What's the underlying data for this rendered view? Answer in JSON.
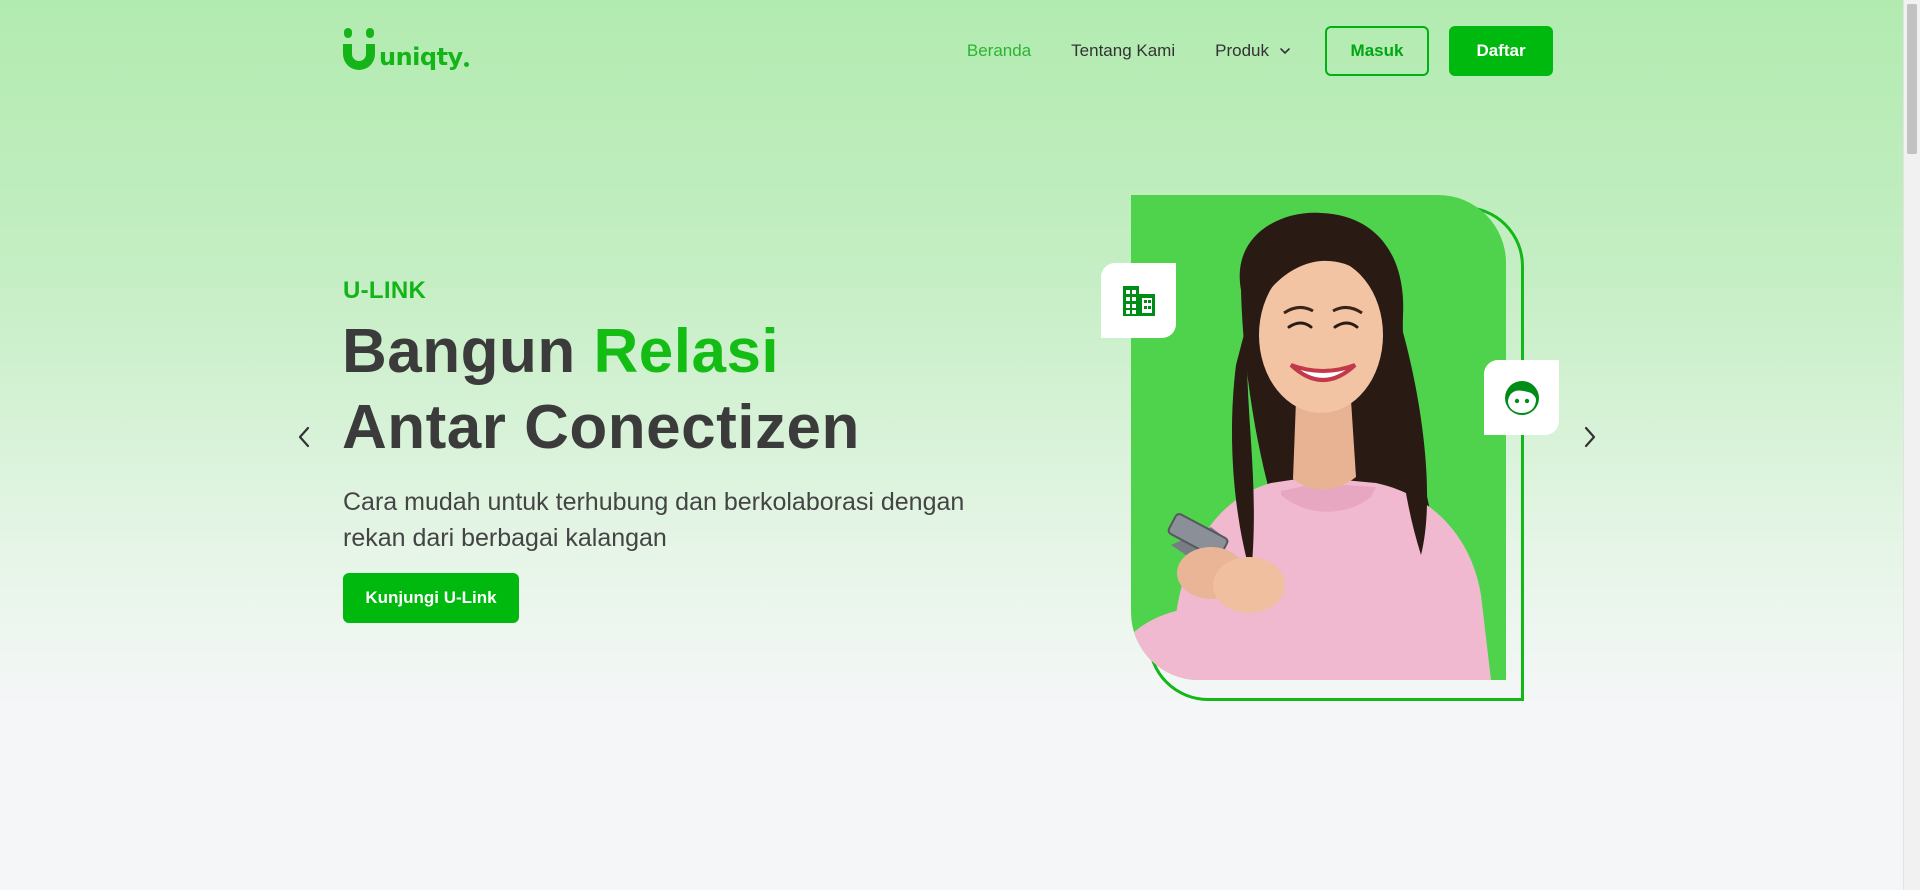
{
  "brand": {
    "name": "uniqty"
  },
  "nav": {
    "links": [
      {
        "label": "Beranda",
        "active": true
      },
      {
        "label": "Tentang Kami",
        "active": false
      }
    ],
    "dropdown_label": "Produk",
    "login_label": "Masuk",
    "register_label": "Daftar"
  },
  "hero": {
    "eyebrow": "U-LINK",
    "headline_part1": "Bangun ",
    "headline_accent": "Relasi",
    "headline_part2": "Antar Conectizen",
    "subtitle": "Cara mudah untuk terhubung dan berkolaborasi dengan rekan dari berbagai kalangan",
    "cta_label": "Kunjungi U-Link"
  },
  "icons": {
    "carousel_prev": "chevron-left-icon",
    "carousel_next": "chevron-right-icon",
    "badge_left": "building-icon",
    "badge_right": "face-icon",
    "dropdown": "chevron-down-icon"
  },
  "colors": {
    "brand_green": "#00b90e",
    "accent_green": "#14bd14",
    "panel_green": "#4fd24c",
    "text_dark": "#3b3b3b",
    "badge_icon_green": "#008d17"
  }
}
